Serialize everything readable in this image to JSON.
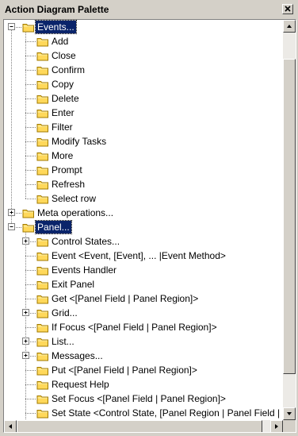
{
  "window": {
    "title": "Action Diagram Palette"
  },
  "colors": {
    "selection_bg": "#0a246a",
    "folder_fill": "#ffd85a",
    "folder_edge": "#a07a00"
  },
  "tree": [
    {
      "label": "Events...",
      "depth": 0,
      "expander": "minus",
      "selected": true
    },
    {
      "label": "Add",
      "depth": 1
    },
    {
      "label": "Close",
      "depth": 1
    },
    {
      "label": "Confirm",
      "depth": 1
    },
    {
      "label": "Copy",
      "depth": 1
    },
    {
      "label": "Delete",
      "depth": 1
    },
    {
      "label": "Enter",
      "depth": 1
    },
    {
      "label": "Filter",
      "depth": 1
    },
    {
      "label": "Modify Tasks",
      "depth": 1
    },
    {
      "label": "More",
      "depth": 1
    },
    {
      "label": "Prompt",
      "depth": 1
    },
    {
      "label": "Refresh",
      "depth": 1
    },
    {
      "label": "Select row",
      "depth": 1
    },
    {
      "label": "Meta operations...",
      "depth": 0,
      "expander": "plus"
    },
    {
      "label": "Panel...",
      "depth": 0,
      "expander": "minus",
      "selected": true
    },
    {
      "label": "Control States...",
      "depth": 1,
      "expander": "plus"
    },
    {
      "label": "Event <Event, [Event], ... |Event Method>",
      "depth": 1
    },
    {
      "label": "Events Handler",
      "depth": 1
    },
    {
      "label": "Exit Panel",
      "depth": 1
    },
    {
      "label": "Get <[Panel Field | Panel Region]>",
      "depth": 1
    },
    {
      "label": "Grid...",
      "depth": 1,
      "expander": "plus"
    },
    {
      "label": "If Focus <[Panel Field | Panel Region]>",
      "depth": 1
    },
    {
      "label": "List...",
      "depth": 1,
      "expander": "plus"
    },
    {
      "label": "Messages...",
      "depth": 1,
      "expander": "plus"
    },
    {
      "label": "Put <[Panel Field | Panel Region]>",
      "depth": 1
    },
    {
      "label": "Request Help",
      "depth": 1
    },
    {
      "label": "Set Focus <[Panel Field | Panel Region]>",
      "depth": 1
    },
    {
      "label": "Set State <Control State, [Panel Region | Panel Field | Event]>",
      "depth": 1
    }
  ],
  "scrollbars": {
    "vertical": {
      "thumb_start": 0.07,
      "thumb_size": 0.84
    },
    "horizontal": {
      "thumb_start": 0.0,
      "thumb_size": 0.97
    }
  }
}
